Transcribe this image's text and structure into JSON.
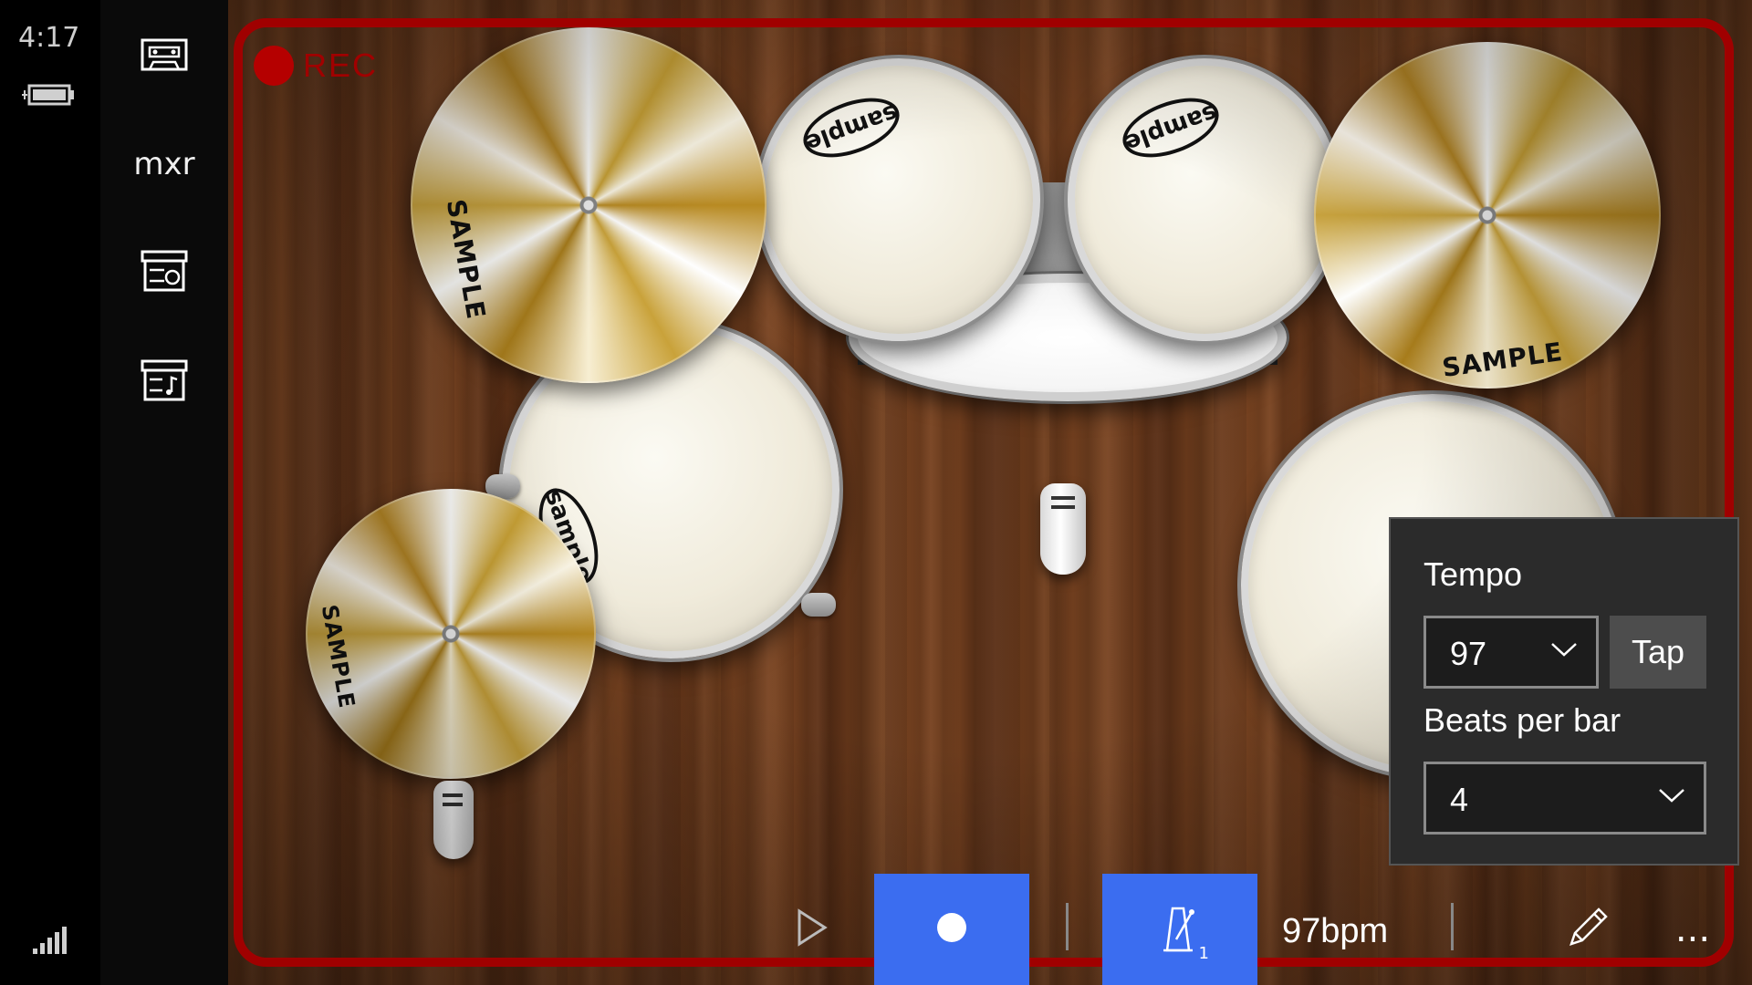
{
  "status": {
    "time": "4:17"
  },
  "sidebar": {
    "mixer_label": "mxr"
  },
  "recording": {
    "label": "REC"
  },
  "kit": {
    "cymbal_brand": "SAMPLE",
    "drum_brand": "sample"
  },
  "metronome": {
    "tempo_label": "Tempo",
    "tempo_value": "97",
    "tap_label": "Tap",
    "beats_label": "Beats per bar",
    "beats_value": "4"
  },
  "transport": {
    "bpm": "97bpm",
    "metronome_beat": "1",
    "more": "..."
  },
  "colors": {
    "accent": "#3b6df0",
    "rec": "#a00000"
  },
  "icons": [
    "battery-icon",
    "signal-icon",
    "tape-icon",
    "record-box-icon",
    "music-box-icon",
    "play-icon",
    "record-icon",
    "metronome-icon",
    "pencil-icon",
    "chevron-down-icon"
  ]
}
